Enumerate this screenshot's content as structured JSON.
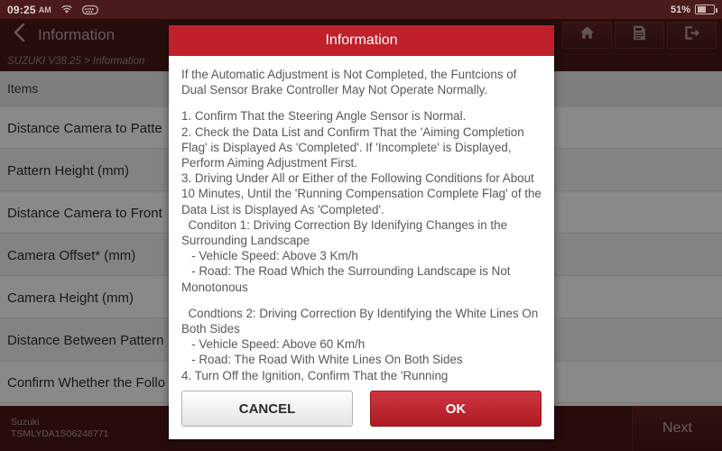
{
  "statusbar": {
    "time": "09:25",
    "ampm": "AM",
    "wifi_icon": "wifi-icon",
    "vci_icon": "vci-connector-icon",
    "battery_percent": "51%",
    "battery_icon": "battery-icon"
  },
  "header": {
    "back_icon": "back-chevron-icon",
    "title": "Information",
    "toolbar": [
      {
        "name": "home-button",
        "icon": "home-icon"
      },
      {
        "name": "report-button",
        "icon": "report-icon"
      },
      {
        "name": "exit-button",
        "icon": "exit-icon"
      }
    ]
  },
  "breadcrumb": {
    "text": "SUZUKI V38.25 > Information"
  },
  "list": {
    "header_label": "Items",
    "rows": [
      {
        "label": "Distance Camera to Patte"
      },
      {
        "label": "Pattern Height (mm)"
      },
      {
        "label": "Distance Camera to Front"
      },
      {
        "label": "Camera Offset* (mm)"
      },
      {
        "label": "Camera Height (mm)"
      },
      {
        "label": "Distance Between Pattern"
      },
      {
        "label": "Confirm Whether the Follo"
      }
    ]
  },
  "footer": {
    "make": "Suzuki",
    "vin": "TSMLYDA1S06248771",
    "next_label": "Next"
  },
  "dialog": {
    "title": "Information",
    "paragraph_1": "If the Automatic Adjustment is Not Completed, the Funtcions of Dual Sensor Brake Controller May Not Operate Normally.",
    "paragraph_2": "1. Confirm That the Steering Angle Sensor is Normal.\n2. Check the Data List and Confirm That the 'Aiming Completion Flag' is Displayed As 'Completed'. If 'Incomplete' is Displayed, Perform Aiming Adjustment First.\n3. Driving Under All or Either of the Following Conditions for About 10 Minutes, Until the 'Running Compensation Complete Flag' of the Data List is Displayed As 'Completed'.\n  Conditon 1: Driving Correction By Idenifying Changes in the Surrounding Landscape\n   - Vehicle Speed: Above 3 Km/h\n   - Road: The Road Which the Surrounding Landscape is Not Monotonous",
    "paragraph_3": "  Condtions 2: Driving Correction By Identifying the White Lines On Both Sides\n   - Vehicle Speed: Above 60 Km/h\n   - Road: The Road With White Lines On Both Sides\n4. Turn Off the Ignition, Confirm That the 'Running",
    "cancel_label": "CANCEL",
    "ok_label": "OK"
  },
  "colors": {
    "brand_red": "#c0202a",
    "header_maroon": "#4a1818",
    "ok_button_red": "#ad1a22"
  }
}
